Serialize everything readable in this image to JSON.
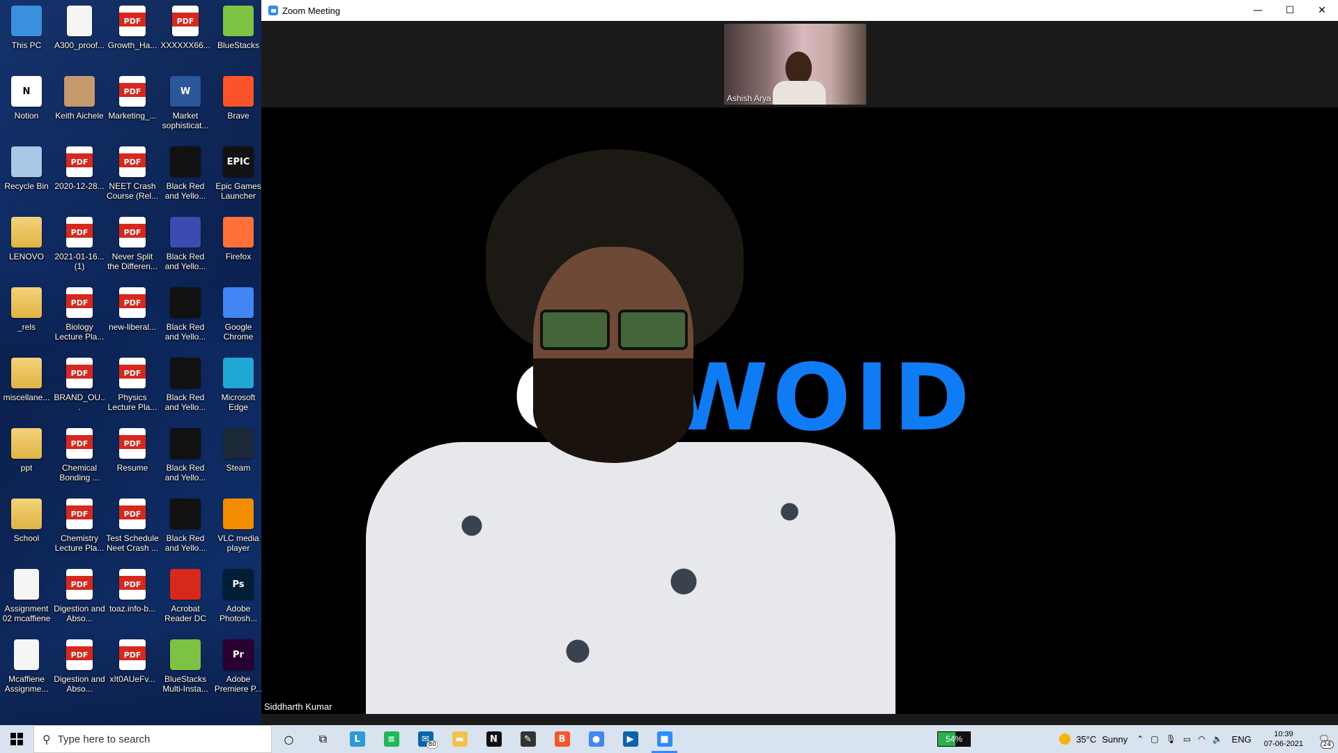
{
  "desktop_icons": [
    {
      "label": "This PC",
      "icon": "pc-icon",
      "type": "sys",
      "color": "#3a8fde"
    },
    {
      "label": "Notion",
      "icon": "notion-icon",
      "type": "app",
      "color": "#ffffff",
      "glyph": "N"
    },
    {
      "label": "Recycle Bin",
      "icon": "recycle-bin-icon",
      "type": "sys",
      "color": "#a8c8e8"
    },
    {
      "label": "LENOVO",
      "icon": "folder-icon",
      "type": "folder"
    },
    {
      "label": "_rels",
      "icon": "folder-icon",
      "type": "folder"
    },
    {
      "label": "miscellane...",
      "icon": "folder-icon",
      "type": "folder"
    },
    {
      "label": "ppt",
      "icon": "folder-icon",
      "type": "folder"
    },
    {
      "label": "School",
      "icon": "folder-icon",
      "type": "folder"
    },
    {
      "label": "Assignment 02 mcaffiene",
      "icon": "document-icon",
      "type": "doc"
    },
    {
      "label": "Mcaffiene Assignme...",
      "icon": "document-icon",
      "type": "doc"
    },
    {
      "label": "A300_proof...",
      "icon": "document-icon",
      "type": "doc"
    },
    {
      "label": "Keith Aichele",
      "icon": "photo-icon",
      "type": "app",
      "color": "#c49a6c"
    },
    {
      "label": "2020-12-28...",
      "icon": "pdf-icon",
      "type": "pdf"
    },
    {
      "label": "2021-01-16... (1)",
      "icon": "pdf-icon",
      "type": "pdf"
    },
    {
      "label": "Biology Lecture Pla...",
      "icon": "pdf-icon",
      "type": "pdf"
    },
    {
      "label": "BRAND_OU...",
      "icon": "pdf-icon",
      "type": "pdf"
    },
    {
      "label": "Chemical Bonding ...",
      "icon": "pdf-icon",
      "type": "pdf"
    },
    {
      "label": "Chemistry Lecture Pla...",
      "icon": "pdf-icon",
      "type": "pdf"
    },
    {
      "label": "Digestion and Abso...",
      "icon": "pdf-icon",
      "type": "pdf"
    },
    {
      "label": "Digestion and Abso...",
      "icon": "pdf-icon",
      "type": "pdf"
    },
    {
      "label": "Growth_Ha...",
      "icon": "pdf-icon",
      "type": "pdf"
    },
    {
      "label": "Marketing_...",
      "icon": "pdf-icon",
      "type": "pdf"
    },
    {
      "label": "NEET Crash Course (Rel...",
      "icon": "pdf-icon",
      "type": "pdf"
    },
    {
      "label": "Never Split the Differen...",
      "icon": "pdf-icon",
      "type": "pdf"
    },
    {
      "label": "new-liberal...",
      "icon": "pdf-icon",
      "type": "pdf"
    },
    {
      "label": "Physics Lecture Pla...",
      "icon": "pdf-icon",
      "type": "pdf"
    },
    {
      "label": "Resume",
      "icon": "pdf-icon",
      "type": "pdf"
    },
    {
      "label": "Test Schedule Neet Crash ...",
      "icon": "pdf-icon",
      "type": "pdf"
    },
    {
      "label": "toaz.info-b...",
      "icon": "pdf-icon",
      "type": "pdf"
    },
    {
      "label": "xIt0AUeFv...",
      "icon": "pdf-icon",
      "type": "pdf"
    },
    {
      "label": "XXXXXX66...",
      "icon": "pdf-icon",
      "type": "pdf"
    },
    {
      "label": "Market sophisticat...",
      "icon": "word-icon",
      "type": "app",
      "color": "#2b579a",
      "glyph": "W"
    },
    {
      "label": "Black Red and Yello...",
      "icon": "image-icon",
      "type": "app",
      "color": "#111111"
    },
    {
      "label": "Black Red and Yello...",
      "icon": "image-icon",
      "type": "app",
      "color": "#3b4bb0"
    },
    {
      "label": "Black Red and Yello...",
      "icon": "image-icon",
      "type": "app",
      "color": "#111111"
    },
    {
      "label": "Black Red and Yello...",
      "icon": "image-icon",
      "type": "app",
      "color": "#111111"
    },
    {
      "label": "Black Red and Yello...",
      "icon": "image-icon",
      "type": "app",
      "color": "#111111"
    },
    {
      "label": "Black Red and Yello...",
      "icon": "image-icon",
      "type": "app",
      "color": "#111111"
    },
    {
      "label": "Acrobat Reader DC",
      "icon": "acrobat-icon",
      "type": "app",
      "color": "#d7281e"
    },
    {
      "label": "BlueStacks Multi-Insta...",
      "icon": "bluestacks-multi-icon",
      "type": "app",
      "color": "#7dc242"
    },
    {
      "label": "BlueStacks",
      "icon": "bluestacks-icon",
      "type": "app",
      "color": "#7dc242"
    },
    {
      "label": "Brave",
      "icon": "brave-icon",
      "type": "app",
      "color": "#fb542b"
    },
    {
      "label": "Epic Games Launcher",
      "icon": "epic-games-icon",
      "type": "app",
      "color": "#111111",
      "glyph": "EPIC"
    },
    {
      "label": "Firefox",
      "icon": "firefox-icon",
      "type": "app",
      "color": "#ff7139"
    },
    {
      "label": "Google Chrome",
      "icon": "chrome-icon",
      "type": "app",
      "color": "#4285f4"
    },
    {
      "label": "Microsoft Edge",
      "icon": "edge-icon",
      "type": "app",
      "color": "#1fa7d6"
    },
    {
      "label": "Steam",
      "icon": "steam-icon",
      "type": "app",
      "color": "#1b2838"
    },
    {
      "label": "VLC media player",
      "icon": "vlc-icon",
      "type": "app",
      "color": "#f28c00"
    },
    {
      "label": "Adobe Photosh...",
      "icon": "photoshop-icon",
      "type": "app",
      "color": "#001e36",
      "glyph": "Ps"
    },
    {
      "label": "Adobe Premiere P...",
      "icon": "premiere-icon",
      "type": "app",
      "color": "#2a0033",
      "glyph": "Pr"
    }
  ],
  "zoom": {
    "title": "Zoom Meeting",
    "thumbnail_name": "Ashish Arya",
    "speaker_name": "Siddharth Kumar",
    "background_logo": {
      "part1": "GR",
      "part2": "WOID"
    }
  },
  "taskbar": {
    "search_placeholder": "Type here to search",
    "mail_badge": "80",
    "battery": "54%",
    "weather_temp": "35°C",
    "weather_text": "Sunny",
    "language": "ENG",
    "time": "10:39",
    "date": "07-06-2021",
    "notifications": "24",
    "apps": [
      {
        "name": "cortana-button",
        "icon": "cortana-icon",
        "glyph": "○",
        "color": "",
        "active": false
      },
      {
        "name": "task-view-button",
        "icon": "task-view-icon",
        "glyph": "⧉",
        "color": "",
        "active": false
      },
      {
        "name": "taskbar-l-app",
        "icon": "l-app-icon",
        "glyph": "L",
        "color": "#2e9bd6",
        "active": false
      },
      {
        "name": "taskbar-spotify",
        "icon": "spotify-icon",
        "glyph": "≡",
        "color": "#1db954",
        "active": false
      },
      {
        "name": "taskbar-mail",
        "icon": "mail-icon",
        "glyph": "✉",
        "color": "#0a64ad",
        "active": false
      },
      {
        "name": "taskbar-explorer",
        "icon": "folder-icon",
        "glyph": "▬",
        "color": "#f3c24a",
        "active": false
      },
      {
        "name": "taskbar-notion",
        "icon": "notion-icon",
        "glyph": "N",
        "color": "#111111",
        "active": false
      },
      {
        "name": "taskbar-sticky-notes",
        "icon": "sticky-notes-icon",
        "glyph": "✎",
        "color": "#333333",
        "active": false
      },
      {
        "name": "taskbar-brave",
        "icon": "brave-icon",
        "glyph": "B",
        "color": "#fb542b",
        "active": false
      },
      {
        "name": "taskbar-chrome",
        "icon": "chrome-icon",
        "glyph": "●",
        "color": "#4285f4",
        "active": false
      },
      {
        "name": "taskbar-media",
        "icon": "media-player-icon",
        "glyph": "▶",
        "color": "#0a64ad",
        "active": false
      },
      {
        "name": "taskbar-zoom",
        "icon": "zoom-icon",
        "glyph": "■",
        "color": "#2d8cff",
        "active": true
      }
    ]
  }
}
